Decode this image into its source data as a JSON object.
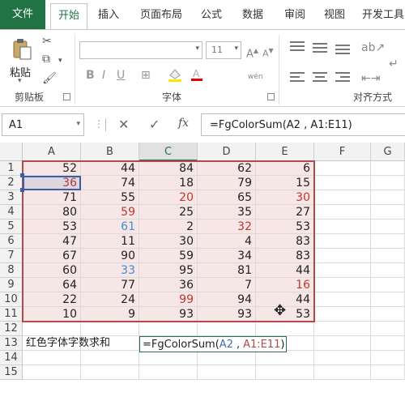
{
  "ribbon_tabs": [
    "文件",
    "开始",
    "插入",
    "页面布局",
    "公式",
    "数据",
    "审阅",
    "视图",
    "开发工具"
  ],
  "ribbon": {
    "paste_label": "粘贴",
    "groups": [
      "剪贴板",
      "字体",
      "对齐方式"
    ],
    "font_size": "11"
  },
  "formula_bar": {
    "name_box": "A1",
    "fx_label": "fx",
    "formula": "=FgColorSum(A2 , A1:E11)"
  },
  "columns": [
    "A",
    "B",
    "C",
    "D",
    "E",
    "F",
    "G"
  ],
  "rows": [
    "1",
    "2",
    "3",
    "4",
    "5",
    "6",
    "7",
    "8",
    "9",
    "10",
    "11",
    "12",
    "13",
    "14",
    "15"
  ],
  "table": [
    [
      {
        "v": "52",
        "c": "black"
      },
      {
        "v": "44",
        "c": "black"
      },
      {
        "v": "84",
        "c": "black"
      },
      {
        "v": "62",
        "c": "black"
      },
      {
        "v": "6",
        "c": "black"
      }
    ],
    [
      {
        "v": "36",
        "c": "red"
      },
      {
        "v": "74",
        "c": "black"
      },
      {
        "v": "18",
        "c": "black"
      },
      {
        "v": "79",
        "c": "black"
      },
      {
        "v": "15",
        "c": "black"
      }
    ],
    [
      {
        "v": "71",
        "c": "black"
      },
      {
        "v": "55",
        "c": "black"
      },
      {
        "v": "20",
        "c": "red"
      },
      {
        "v": "65",
        "c": "black"
      },
      {
        "v": "30",
        "c": "red"
      }
    ],
    [
      {
        "v": "80",
        "c": "black"
      },
      {
        "v": "59",
        "c": "red"
      },
      {
        "v": "25",
        "c": "black"
      },
      {
        "v": "35",
        "c": "black"
      },
      {
        "v": "27",
        "c": "black"
      }
    ],
    [
      {
        "v": "53",
        "c": "black"
      },
      {
        "v": "61",
        "c": "blue"
      },
      {
        "v": "2",
        "c": "black"
      },
      {
        "v": "32",
        "c": "red"
      },
      {
        "v": "53",
        "c": "black"
      }
    ],
    [
      {
        "v": "47",
        "c": "black"
      },
      {
        "v": "11",
        "c": "black"
      },
      {
        "v": "30",
        "c": "black"
      },
      {
        "v": "4",
        "c": "black"
      },
      {
        "v": "83",
        "c": "black"
      }
    ],
    [
      {
        "v": "67",
        "c": "black"
      },
      {
        "v": "90",
        "c": "black"
      },
      {
        "v": "59",
        "c": "black"
      },
      {
        "v": "34",
        "c": "black"
      },
      {
        "v": "83",
        "c": "black"
      }
    ],
    [
      {
        "v": "60",
        "c": "black"
      },
      {
        "v": "33",
        "c": "blue"
      },
      {
        "v": "95",
        "c": "black"
      },
      {
        "v": "81",
        "c": "black"
      },
      {
        "v": "44",
        "c": "black"
      }
    ],
    [
      {
        "v": "64",
        "c": "black"
      },
      {
        "v": "77",
        "c": "black"
      },
      {
        "v": "36",
        "c": "black"
      },
      {
        "v": "7",
        "c": "black"
      },
      {
        "v": "16",
        "c": "red"
      }
    ],
    [
      {
        "v": "22",
        "c": "black"
      },
      {
        "v": "24",
        "c": "black"
      },
      {
        "v": "99",
        "c": "red"
      },
      {
        "v": "94",
        "c": "black"
      },
      {
        "v": "44",
        "c": "black"
      }
    ],
    [
      {
        "v": "10",
        "c": "black"
      },
      {
        "v": "9",
        "c": "black"
      },
      {
        "v": "93",
        "c": "black"
      },
      {
        "v": "93",
        "c": "black"
      },
      {
        "v": "53",
        "c": "black"
      }
    ]
  ],
  "row13": {
    "label": "红色字体字数求和",
    "editing_prefix": "=FgColorSum(",
    "arg1": "A2",
    "sep": ",",
    "arg2": "A1:E11",
    "close": ")"
  },
  "colors": {
    "accent": "#217346",
    "red_text": "#c0392b",
    "blue_text": "#3d8fd1",
    "range_fill": "#f6e6e6"
  }
}
